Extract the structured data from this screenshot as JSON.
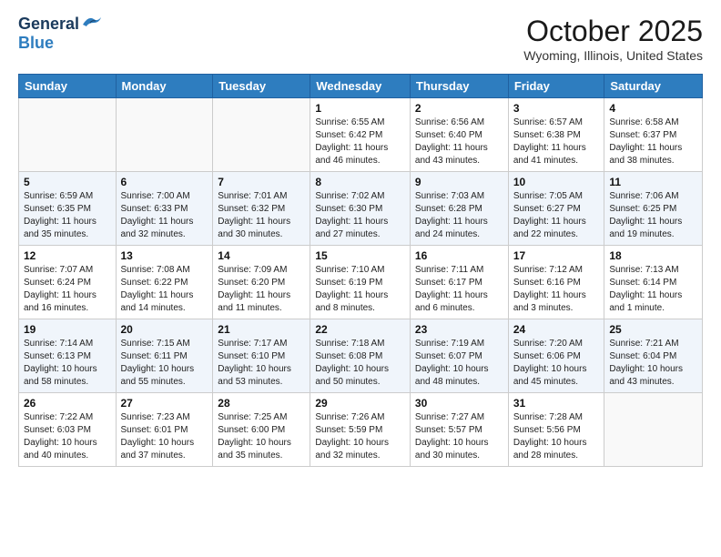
{
  "header": {
    "logo_general": "General",
    "logo_blue": "Blue",
    "month": "October 2025",
    "location": "Wyoming, Illinois, United States"
  },
  "weekdays": [
    "Sunday",
    "Monday",
    "Tuesday",
    "Wednesday",
    "Thursday",
    "Friday",
    "Saturday"
  ],
  "weeks": [
    [
      {
        "day": "",
        "info": ""
      },
      {
        "day": "",
        "info": ""
      },
      {
        "day": "",
        "info": ""
      },
      {
        "day": "1",
        "info": "Sunrise: 6:55 AM\nSunset: 6:42 PM\nDaylight: 11 hours\nand 46 minutes."
      },
      {
        "day": "2",
        "info": "Sunrise: 6:56 AM\nSunset: 6:40 PM\nDaylight: 11 hours\nand 43 minutes."
      },
      {
        "day": "3",
        "info": "Sunrise: 6:57 AM\nSunset: 6:38 PM\nDaylight: 11 hours\nand 41 minutes."
      },
      {
        "day": "4",
        "info": "Sunrise: 6:58 AM\nSunset: 6:37 PM\nDaylight: 11 hours\nand 38 minutes."
      }
    ],
    [
      {
        "day": "5",
        "info": "Sunrise: 6:59 AM\nSunset: 6:35 PM\nDaylight: 11 hours\nand 35 minutes."
      },
      {
        "day": "6",
        "info": "Sunrise: 7:00 AM\nSunset: 6:33 PM\nDaylight: 11 hours\nand 32 minutes."
      },
      {
        "day": "7",
        "info": "Sunrise: 7:01 AM\nSunset: 6:32 PM\nDaylight: 11 hours\nand 30 minutes."
      },
      {
        "day": "8",
        "info": "Sunrise: 7:02 AM\nSunset: 6:30 PM\nDaylight: 11 hours\nand 27 minutes."
      },
      {
        "day": "9",
        "info": "Sunrise: 7:03 AM\nSunset: 6:28 PM\nDaylight: 11 hours\nand 24 minutes."
      },
      {
        "day": "10",
        "info": "Sunrise: 7:05 AM\nSunset: 6:27 PM\nDaylight: 11 hours\nand 22 minutes."
      },
      {
        "day": "11",
        "info": "Sunrise: 7:06 AM\nSunset: 6:25 PM\nDaylight: 11 hours\nand 19 minutes."
      }
    ],
    [
      {
        "day": "12",
        "info": "Sunrise: 7:07 AM\nSunset: 6:24 PM\nDaylight: 11 hours\nand 16 minutes."
      },
      {
        "day": "13",
        "info": "Sunrise: 7:08 AM\nSunset: 6:22 PM\nDaylight: 11 hours\nand 14 minutes."
      },
      {
        "day": "14",
        "info": "Sunrise: 7:09 AM\nSunset: 6:20 PM\nDaylight: 11 hours\nand 11 minutes."
      },
      {
        "day": "15",
        "info": "Sunrise: 7:10 AM\nSunset: 6:19 PM\nDaylight: 11 hours\nand 8 minutes."
      },
      {
        "day": "16",
        "info": "Sunrise: 7:11 AM\nSunset: 6:17 PM\nDaylight: 11 hours\nand 6 minutes."
      },
      {
        "day": "17",
        "info": "Sunrise: 7:12 AM\nSunset: 6:16 PM\nDaylight: 11 hours\nand 3 minutes."
      },
      {
        "day": "18",
        "info": "Sunrise: 7:13 AM\nSunset: 6:14 PM\nDaylight: 11 hours\nand 1 minute."
      }
    ],
    [
      {
        "day": "19",
        "info": "Sunrise: 7:14 AM\nSunset: 6:13 PM\nDaylight: 10 hours\nand 58 minutes."
      },
      {
        "day": "20",
        "info": "Sunrise: 7:15 AM\nSunset: 6:11 PM\nDaylight: 10 hours\nand 55 minutes."
      },
      {
        "day": "21",
        "info": "Sunrise: 7:17 AM\nSunset: 6:10 PM\nDaylight: 10 hours\nand 53 minutes."
      },
      {
        "day": "22",
        "info": "Sunrise: 7:18 AM\nSunset: 6:08 PM\nDaylight: 10 hours\nand 50 minutes."
      },
      {
        "day": "23",
        "info": "Sunrise: 7:19 AM\nSunset: 6:07 PM\nDaylight: 10 hours\nand 48 minutes."
      },
      {
        "day": "24",
        "info": "Sunrise: 7:20 AM\nSunset: 6:06 PM\nDaylight: 10 hours\nand 45 minutes."
      },
      {
        "day": "25",
        "info": "Sunrise: 7:21 AM\nSunset: 6:04 PM\nDaylight: 10 hours\nand 43 minutes."
      }
    ],
    [
      {
        "day": "26",
        "info": "Sunrise: 7:22 AM\nSunset: 6:03 PM\nDaylight: 10 hours\nand 40 minutes."
      },
      {
        "day": "27",
        "info": "Sunrise: 7:23 AM\nSunset: 6:01 PM\nDaylight: 10 hours\nand 37 minutes."
      },
      {
        "day": "28",
        "info": "Sunrise: 7:25 AM\nSunset: 6:00 PM\nDaylight: 10 hours\nand 35 minutes."
      },
      {
        "day": "29",
        "info": "Sunrise: 7:26 AM\nSunset: 5:59 PM\nDaylight: 10 hours\nand 32 minutes."
      },
      {
        "day": "30",
        "info": "Sunrise: 7:27 AM\nSunset: 5:57 PM\nDaylight: 10 hours\nand 30 minutes."
      },
      {
        "day": "31",
        "info": "Sunrise: 7:28 AM\nSunset: 5:56 PM\nDaylight: 10 hours\nand 28 minutes."
      },
      {
        "day": "",
        "info": ""
      }
    ]
  ]
}
